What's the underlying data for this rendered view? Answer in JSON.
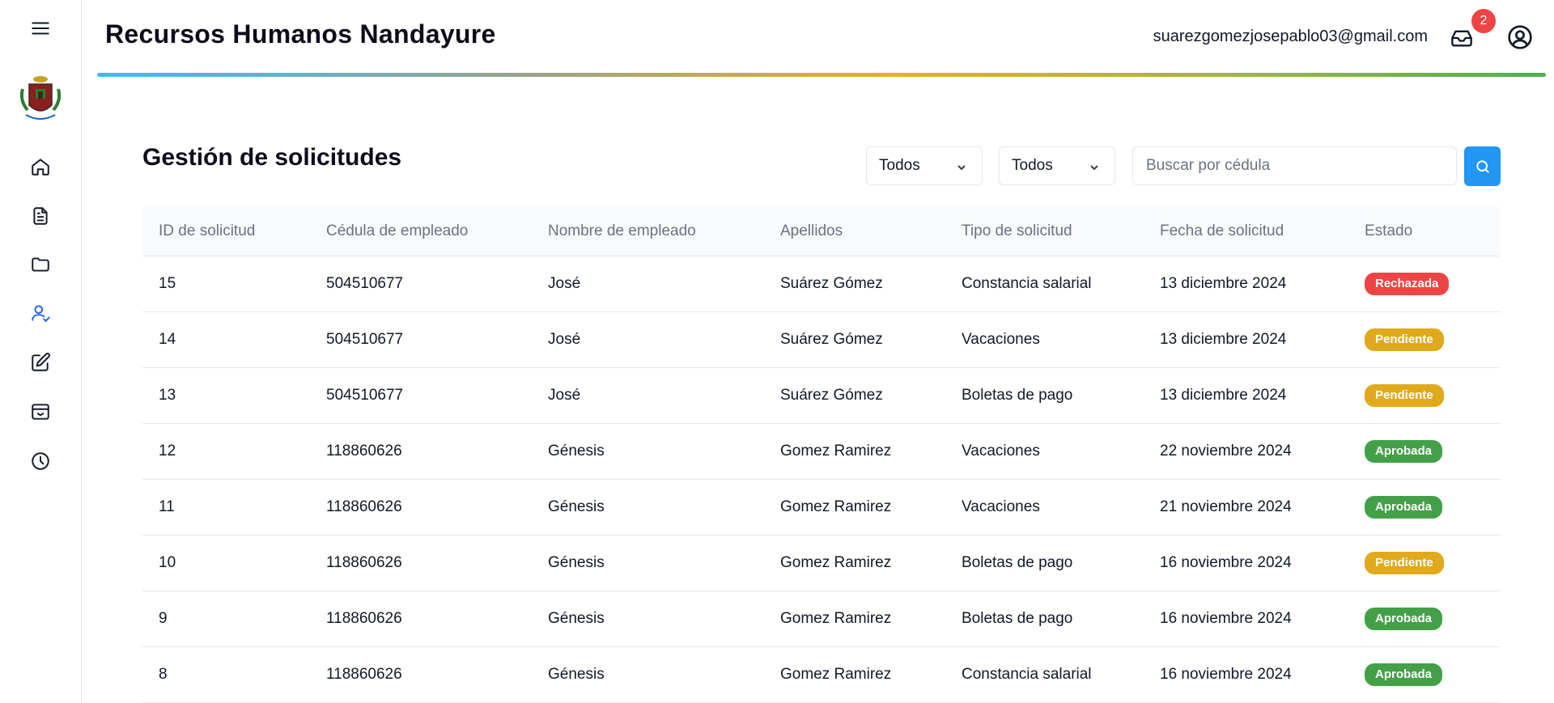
{
  "header": {
    "app_title": "Recursos Humanos Nandayure",
    "user_email": "suarezgomezjosepablo03@gmail.com",
    "notification_count": "2"
  },
  "sidebar": {
    "items": [
      {
        "name": "home",
        "icon": "home-icon"
      },
      {
        "name": "documents",
        "icon": "document-icon"
      },
      {
        "name": "folders",
        "icon": "folder-icon"
      },
      {
        "name": "requests",
        "icon": "user-check-icon",
        "active": true
      },
      {
        "name": "edit",
        "icon": "edit-icon"
      },
      {
        "name": "archive",
        "icon": "archive-icon"
      },
      {
        "name": "history",
        "icon": "clock-icon"
      }
    ]
  },
  "main": {
    "title": "Gestión de solicitudes",
    "filters": {
      "type_filter": "Todos",
      "status_filter": "Todos",
      "search_placeholder": "Buscar por cédula"
    },
    "columns": [
      "ID de solicitud",
      "Cédula de empleado",
      "Nombre de empleado",
      "Apellidos",
      "Tipo de solicitud",
      "Fecha de solicitud",
      "Estado"
    ],
    "rows": [
      {
        "id": "15",
        "cedula": "504510677",
        "nombre": "José",
        "apellidos": "Suárez Gómez",
        "tipo": "Constancia salarial",
        "fecha": "13 diciembre 2024",
        "estado": "Rechazada",
        "color": "#ef4444"
      },
      {
        "id": "14",
        "cedula": "504510677",
        "nombre": "José",
        "apellidos": "Suárez Gómez",
        "tipo": "Vacaciones",
        "fecha": "13 diciembre 2024",
        "estado": "Pendiente",
        "color": "#e0aa1c"
      },
      {
        "id": "13",
        "cedula": "504510677",
        "nombre": "José",
        "apellidos": "Suárez Gómez",
        "tipo": "Boletas de pago",
        "fecha": "13 diciembre 2024",
        "estado": "Pendiente",
        "color": "#e0aa1c"
      },
      {
        "id": "12",
        "cedula": "118860626",
        "nombre": "Génesis",
        "apellidos": "Gomez Ramirez",
        "tipo": "Vacaciones",
        "fecha": "22 noviembre 2024",
        "estado": "Aprobada",
        "color": "#43a047"
      },
      {
        "id": "11",
        "cedula": "118860626",
        "nombre": "Génesis",
        "apellidos": "Gomez Ramirez",
        "tipo": "Vacaciones",
        "fecha": "21 noviembre 2024",
        "estado": "Aprobada",
        "color": "#43a047"
      },
      {
        "id": "10",
        "cedula": "118860626",
        "nombre": "Génesis",
        "apellidos": "Gomez Ramirez",
        "tipo": "Boletas de pago",
        "fecha": "16 noviembre 2024",
        "estado": "Pendiente",
        "color": "#e0aa1c"
      },
      {
        "id": "9",
        "cedula": "118860626",
        "nombre": "Génesis",
        "apellidos": "Gomez Ramirez",
        "tipo": "Boletas de pago",
        "fecha": "16 noviembre 2024",
        "estado": "Aprobada",
        "color": "#43a047"
      },
      {
        "id": "8",
        "cedula": "118860626",
        "nombre": "Génesis",
        "apellidos": "Gomez Ramirez",
        "tipo": "Constancia salarial",
        "fecha": "16 noviembre 2024",
        "estado": "Aprobada",
        "color": "#43a047"
      }
    ]
  },
  "colors": {
    "accent": "#2196f3",
    "rechazada": "#ef4444",
    "pendiente": "#e0aa1c",
    "aprobada": "#43a047"
  }
}
